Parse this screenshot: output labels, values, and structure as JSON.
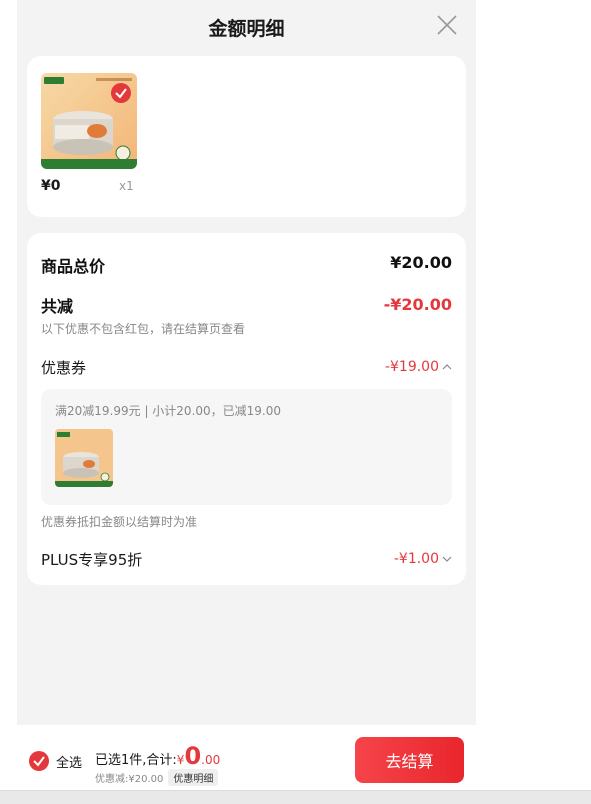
{
  "header": {
    "title": "金额明细"
  },
  "product": {
    "price": "¥0",
    "qty": "x1"
  },
  "summary": {
    "total_label": "商品总价",
    "total_value": "¥20.00",
    "reduce_label": "共减",
    "reduce_value": "-¥20.00",
    "reduce_note": "以下优惠不包含红包，请在结算页查看"
  },
  "coupon": {
    "label": "优惠券",
    "value": "-¥19.00",
    "desc": "满20减19.99元 | 小计20.00，已减19.00",
    "note": "优惠券抵扣金额以结算时为准"
  },
  "plus": {
    "label": "PLUS专享95折",
    "value": "-¥1.00"
  },
  "footer": {
    "select_all": "全选",
    "selected_text": "已选1件,合计:",
    "currency": "¥",
    "amount_int": "0",
    "amount_dec": ".00",
    "discount_text": "优惠减:¥20.00",
    "detail_chip": "优惠明细",
    "checkout": "去结算"
  },
  "colors": {
    "accent": "#e4393c",
    "background": "#f3f3f3"
  }
}
